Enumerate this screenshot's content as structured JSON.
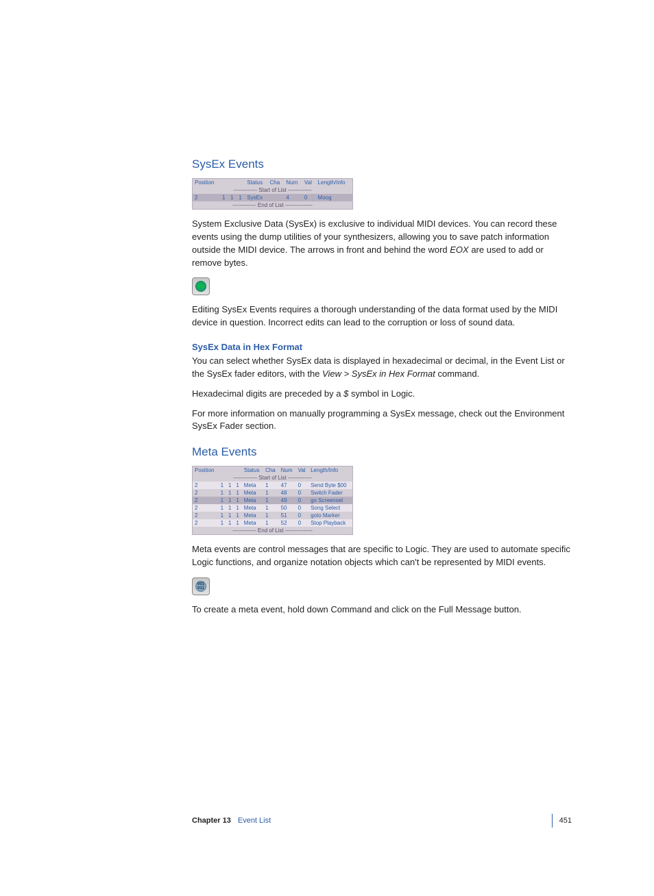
{
  "section1": {
    "heading": "SysEx Events",
    "table": {
      "headers": [
        "Position",
        "",
        "",
        "",
        "Status",
        "Cha",
        "Num",
        "Val",
        "Length/Info"
      ],
      "start_sep": "------------- Start of List -------------",
      "end_sep": "------------- End of List ---------------",
      "rows": [
        {
          "pos": [
            "2",
            "1",
            "1",
            "1"
          ],
          "status": "SysEx",
          "cha": "",
          "num": "4",
          "val": "0",
          "info": "Moog"
        }
      ]
    },
    "p1_a": "System Exclusive Data (SysEx) is exclusive to individual MIDI devices. You can record these events using the dump utilities of your synthesizers, allowing you to save patch information outside the MIDI device. The arrows in front and behind the word ",
    "p1_b": "EOX",
    "p1_c": " are used to add or remove bytes.",
    "icon_label": "SysEx",
    "p2": "Editing SysEx Events requires a thorough understanding of the data format used by the MIDI device in question. Incorrect edits can lead to the corruption or loss of sound data."
  },
  "subsection1": {
    "heading": "SysEx Data in Hex Format",
    "p1_a": "You can select whether SysEx data is displayed in hexadecimal or decimal, in the Event List or the SysEx fader editors, with the ",
    "p1_b": "View > SysEx in Hex Format",
    "p1_c": " command.",
    "p2_a": "Hexadecimal digits are preceded by a ",
    "p2_b": "$",
    "p2_c": " symbol in Logic.",
    "p3": "For more information on manually programming a SysEx message, check out the Environment SysEx Fader section."
  },
  "section2": {
    "heading": "Meta Events",
    "table": {
      "headers": [
        "Position",
        "",
        "",
        "",
        "Status",
        "Cha",
        "Num",
        "Val",
        "Length/Info"
      ],
      "start_sep": "------------- Start of List -------------",
      "end_sep": "------------- End of List ---------------",
      "rows": [
        {
          "pos": [
            "2",
            "1",
            "1",
            "1"
          ],
          "status": "Meta",
          "cha": "1",
          "num": "47",
          "val": "0",
          "info": "Send Byte     $00"
        },
        {
          "pos": [
            "2",
            "1",
            "1",
            "1"
          ],
          "status": "Meta",
          "cha": "1",
          "num": "48",
          "val": "0",
          "info": "Switch Fader"
        },
        {
          "pos": [
            "2",
            "1",
            "1",
            "1"
          ],
          "status": "Meta",
          "cha": "1",
          "num": "49",
          "val": "0",
          "info": "go Screenset"
        },
        {
          "pos": [
            "2",
            "1",
            "1",
            "1"
          ],
          "status": "Meta",
          "cha": "1",
          "num": "50",
          "val": "0",
          "info": "Song Select"
        },
        {
          "pos": [
            "2",
            "1",
            "1",
            "1"
          ],
          "status": "Meta",
          "cha": "1",
          "num": "51",
          "val": "0",
          "info": "goto Marker"
        },
        {
          "pos": [
            "2",
            "1",
            "1",
            "1"
          ],
          "status": "Meta",
          "cha": "1",
          "num": "52",
          "val": "0",
          "info": "Stop Playback"
        }
      ]
    },
    "p1": "Meta events are control messages that are specific to Logic. They are used to automate specific Logic functions, and organize notation objects which can't be represented by MIDI events.",
    "icon_label": "001\n011",
    "p2": "To create a meta event, hold down Command and click on the Full Message button."
  },
  "footer": {
    "chapter": "Chapter 13",
    "chapter_name": "Event List",
    "page": "451"
  }
}
